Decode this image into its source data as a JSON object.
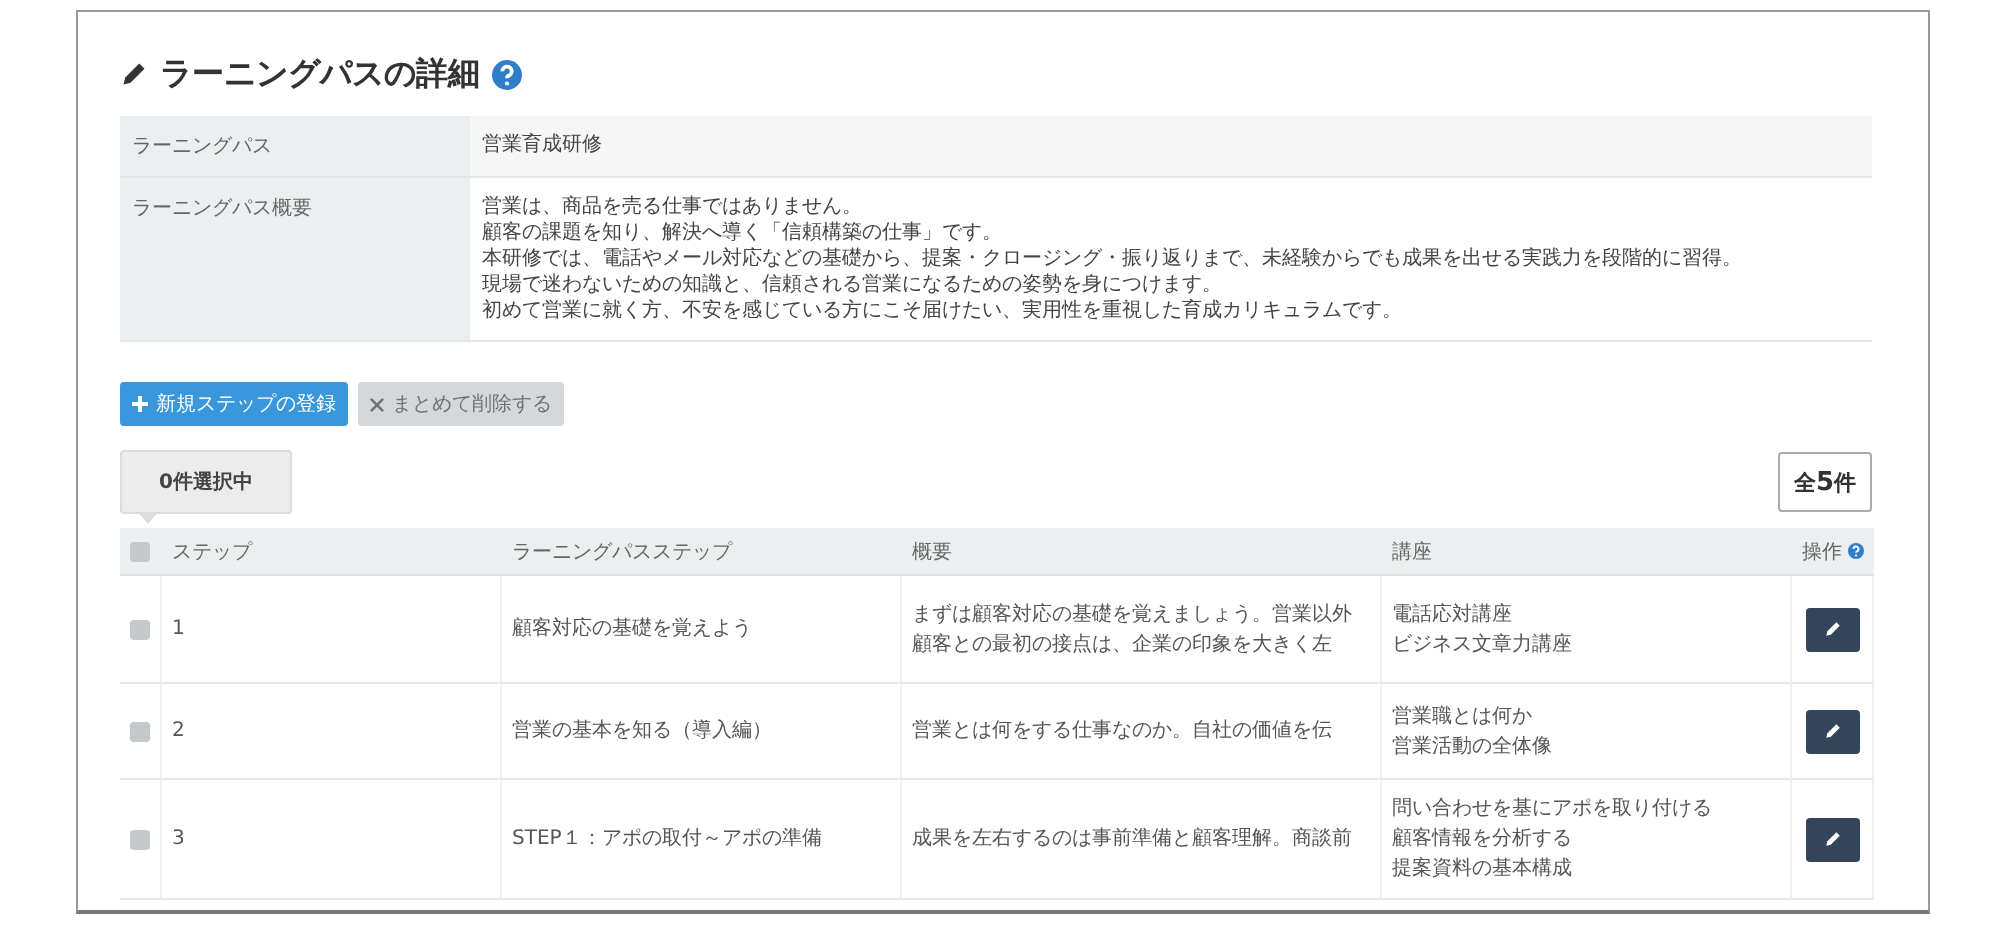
{
  "title": "ラーニングパスの詳細",
  "info": [
    {
      "label": "ラーニングパス",
      "lines": [
        "営業育成研修"
      ]
    },
    {
      "label": "ラーニングパス概要",
      "lines": [
        "営業は、商品を売る仕事ではありません。",
        "顧客の課題を知り、解決へ導く「信頼構築の仕事」です。",
        "本研修では、電話やメール対応などの基礎から、提案・クロージング・振り返りまで、未経験からでも成果を出せる実践力を段階的に習得。",
        "現場で迷わないための知識と、信頼される営業になるための姿勢を身につけます。",
        "初めて営業に就く方、不安を感じている方にこそ届けたい、実用性を重視した育成カリキュラムです。"
      ]
    }
  ],
  "buttons": [
    {
      "label": "新規ステップの登録",
      "disabled": false
    },
    {
      "label": "まとめて削除する",
      "disabled": true
    }
  ],
  "selection_count": "0件選択中",
  "total_count": {
    "prefix": "全",
    "number": "5",
    "suffix": "件"
  },
  "table": {
    "select_all_checked": false,
    "columns": [
      "ステップ",
      "ラーニングパスステップ",
      "概要",
      "講座",
      "操作"
    ],
    "rows": [
      {
        "checked": false,
        "step": "1",
        "name": "顧客対応の基礎を覚えよう",
        "summary": [
          "まずは顧客対応の基礎を覚えましょう。営業以外",
          "顧客との最初の接点は、企業の印象を大きく左"
        ],
        "courses": [
          "電話応対講座",
          "ビジネス文章力講座"
        ]
      },
      {
        "checked": false,
        "step": "2",
        "name": "営業の基本を知る（導入編）",
        "summary": [
          "営業とは何をする仕事なのか。自社の価値を伝"
        ],
        "courses": [
          "営業職とは何か",
          "営業活動の全体像"
        ]
      },
      {
        "checked": false,
        "step": "3",
        "name": "STEP１：アポの取付～アポの準備",
        "summary": [
          "成果を左右するのは事前準備と顧客理解。商談前"
        ],
        "courses": [
          "問い合わせを基にアポを取り付ける",
          "顧客情報を分析する",
          "提案資料の基本構成"
        ]
      }
    ]
  }
}
